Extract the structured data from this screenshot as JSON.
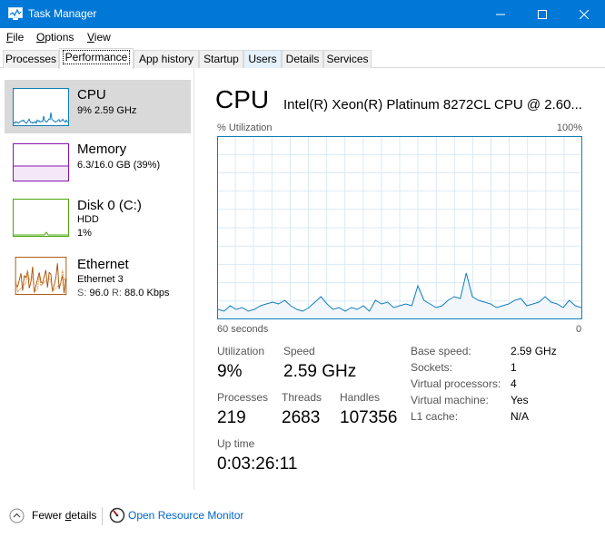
{
  "window": {
    "title": "Task Manager",
    "colors": {
      "titlebar": "#0078d7",
      "cpu_accent": "#117dbb",
      "memory_accent": "#8b12ae",
      "disk_accent": "#4da60c",
      "ethernet_accent": "#a74f01"
    }
  },
  "menu": [
    {
      "key": "F",
      "rest": "ile"
    },
    {
      "key": "O",
      "rest": "ptions"
    },
    {
      "key": "V",
      "rest": "iew"
    }
  ],
  "tabs": [
    "Processes",
    "Performance",
    "App history",
    "Startup",
    "Users",
    "Details",
    "Services"
  ],
  "active_tab": "Performance",
  "sidebar": {
    "cpu": {
      "name": "CPU",
      "sub": "9%  2.59 GHz"
    },
    "memory": {
      "name": "Memory",
      "sub": "6.3/16.0 GB (39%)"
    },
    "disk": {
      "name": "Disk 0 (C:)",
      "sub1": "HDD",
      "sub2": "1%"
    },
    "ethernet": {
      "name": "Ethernet",
      "sub1": "Ethernet 3",
      "s_label": "S:",
      "s_value": "96.0",
      "r_label": "R:",
      "r_value": "88.0 Kbps"
    }
  },
  "main": {
    "title": "CPU",
    "model": "Intel(R) Xeon(R) Platinum 8272CL CPU @ 2.60...",
    "util_label": "% Utilization",
    "util_max": "100%",
    "axis_left": "60 seconds",
    "axis_right": "0",
    "cpu_history_percent": [
      5,
      4,
      7,
      5,
      6,
      4,
      5,
      7,
      8,
      9,
      8,
      10,
      7,
      5,
      4,
      6,
      9,
      12,
      8,
      5,
      6,
      4,
      6,
      5,
      7,
      4,
      10,
      8,
      9,
      6,
      7,
      8,
      7,
      18,
      10,
      8,
      6,
      7,
      10,
      12,
      11,
      25,
      12,
      10,
      9,
      8,
      6,
      7,
      8,
      10,
      11,
      7,
      8,
      9,
      12,
      9,
      8,
      6,
      10,
      7,
      6
    ]
  },
  "stats": {
    "utilization": {
      "label": "Utilization",
      "value": "9%"
    },
    "speed": {
      "label": "Speed",
      "value": "2.59 GHz"
    },
    "processes": {
      "label": "Processes",
      "value": "219"
    },
    "threads": {
      "label": "Threads",
      "value": "2683"
    },
    "handles": {
      "label": "Handles",
      "value": "107356"
    },
    "uptime": {
      "label": "Up time",
      "value": "0:03:26:11"
    }
  },
  "info": [
    {
      "label": "Base speed:",
      "value": "2.59 GHz"
    },
    {
      "label": "Sockets:",
      "value": "1"
    },
    {
      "label": "Virtual processors:",
      "value": "4"
    },
    {
      "label": "Virtual machine:",
      "value": "Yes"
    },
    {
      "label": "L1 cache:",
      "value": "N/A"
    }
  ],
  "footer": {
    "fewer_details_pre": "Fewer ",
    "fewer_details_key": "d",
    "fewer_details_post": "etails",
    "open_resource_monitor": "Open Resource Monitor"
  }
}
